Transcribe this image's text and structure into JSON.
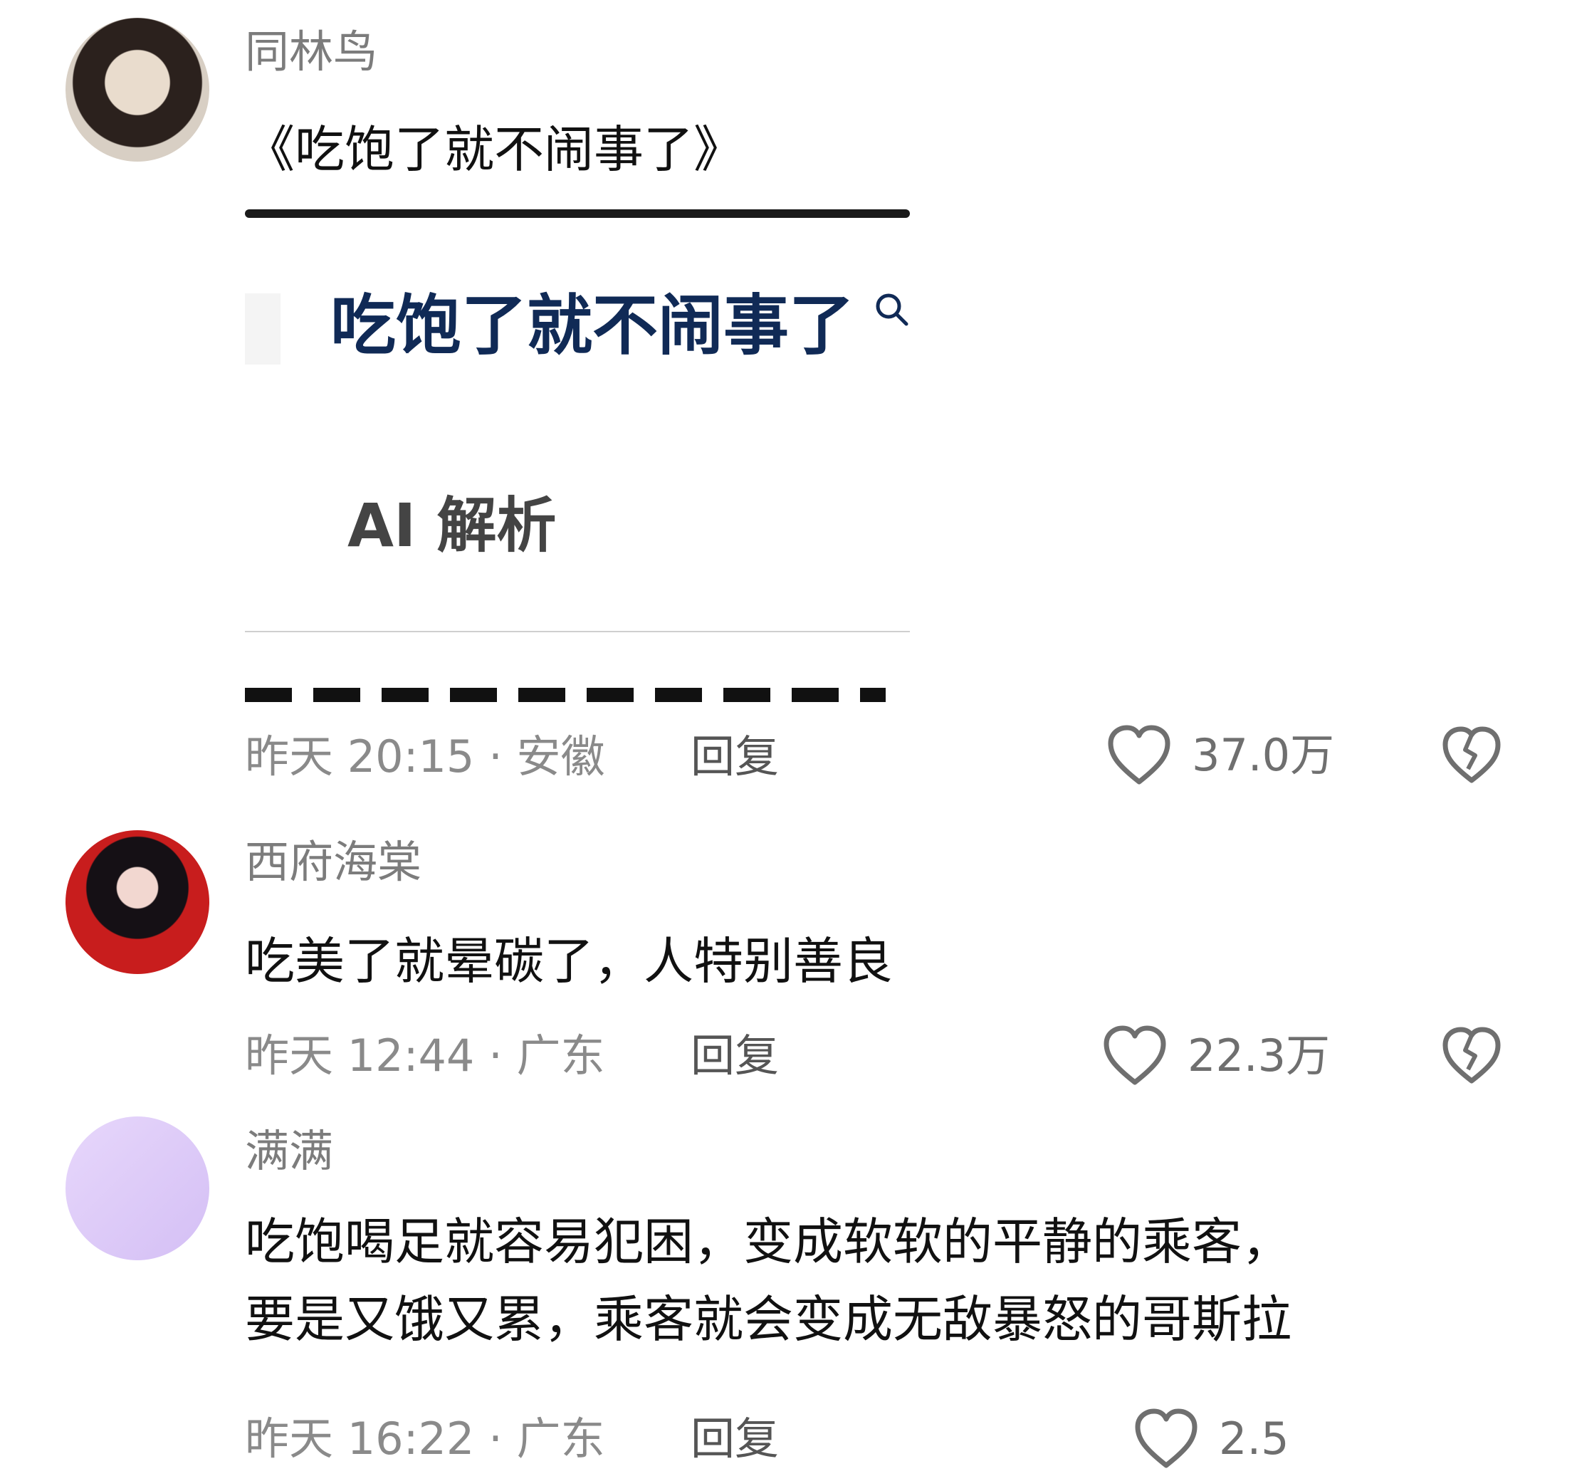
{
  "comments": [
    {
      "username": "同林鸟",
      "text": "《吃饱了就不闹事了》",
      "embed": {
        "query": "吃饱了就不闹事了",
        "ai_label": "AI 解析"
      },
      "meta": "昨天 20:15 · 安徽",
      "reply": "回复",
      "likes": "37.0万"
    },
    {
      "username": "西府海棠",
      "text": "吃美了就晕碳了，人特别善良",
      "meta": "昨天 12:44 · 广东",
      "reply": "回复",
      "likes": "22.3万"
    },
    {
      "username": "满满",
      "text": "吃饱喝足就容易犯困，变成软软的平静的乘客，\n要是又饿又累，乘客就会变成无敌暴怒的哥斯拉",
      "meta": "昨天 16:22 · 广东",
      "reply": "回复",
      "likes": "2.5"
    }
  ],
  "icons": {
    "like": "heart-outline-icon",
    "dislike": "broken-heart-icon",
    "search": "search-icon"
  },
  "colors": {
    "text": "#111111",
    "meta": "#8a8a8a",
    "query": "#102a56"
  }
}
